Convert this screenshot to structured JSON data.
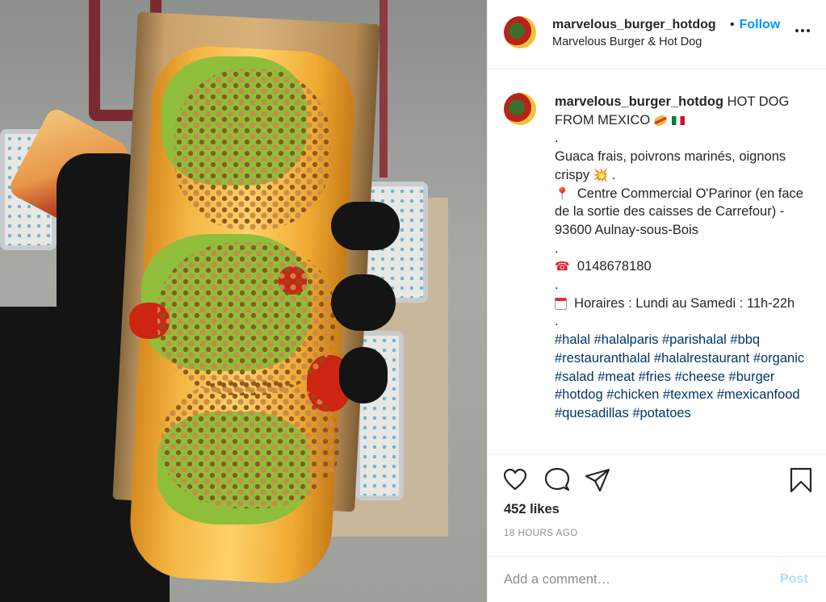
{
  "post": {
    "username": "marvelous_burger_hotdog",
    "location": "Marvelous Burger & Hot Dog",
    "follow_label": "Follow",
    "dot_separator": "•"
  },
  "caption": {
    "username": "marvelous_burger_hotdog",
    "title": "HOT DOG FROM MEXICO",
    "dot1": ".",
    "line1": "Guaca frais, poivrons marinés, oignons crispy",
    "line1_end": ".",
    "address": "Centre Commercial O'Parinor (en face de la sortie des caisses de Carrefour) - 93600 Aulnay-sous-Bois",
    "dot2": ".",
    "phone": "0148678180",
    "dot3": ".",
    "hours": "Horaires : Lundi au Samedi : 11h-22h",
    "dot4": ".",
    "hashtags": "#halal #halalparis #parishalal #bbq #restauranthalal #halalrestaurant #organic #salad #meat #fries #cheese #burger #hotdog #chicken #texmex #mexicanfood #quesadillas #potatoes"
  },
  "emoji": {
    "boom": "💥",
    "pin": "📍",
    "phone": "☎"
  },
  "icons": {
    "like": "heart-icon",
    "comment": "comment-icon",
    "share": "paper-plane-icon",
    "save": "bookmark-icon",
    "more": "more-dots-icon"
  },
  "stats": {
    "likes": "452 likes",
    "time": "18 HOURS AGO"
  },
  "comment": {
    "placeholder": "Add a comment…",
    "post_label": "Post"
  },
  "colors": {
    "link_blue": "#0095f6",
    "hashtag": "#00376b",
    "post_disabled": "#b2dffc",
    "muted": "#8e8e8e",
    "border": "#efefef"
  }
}
